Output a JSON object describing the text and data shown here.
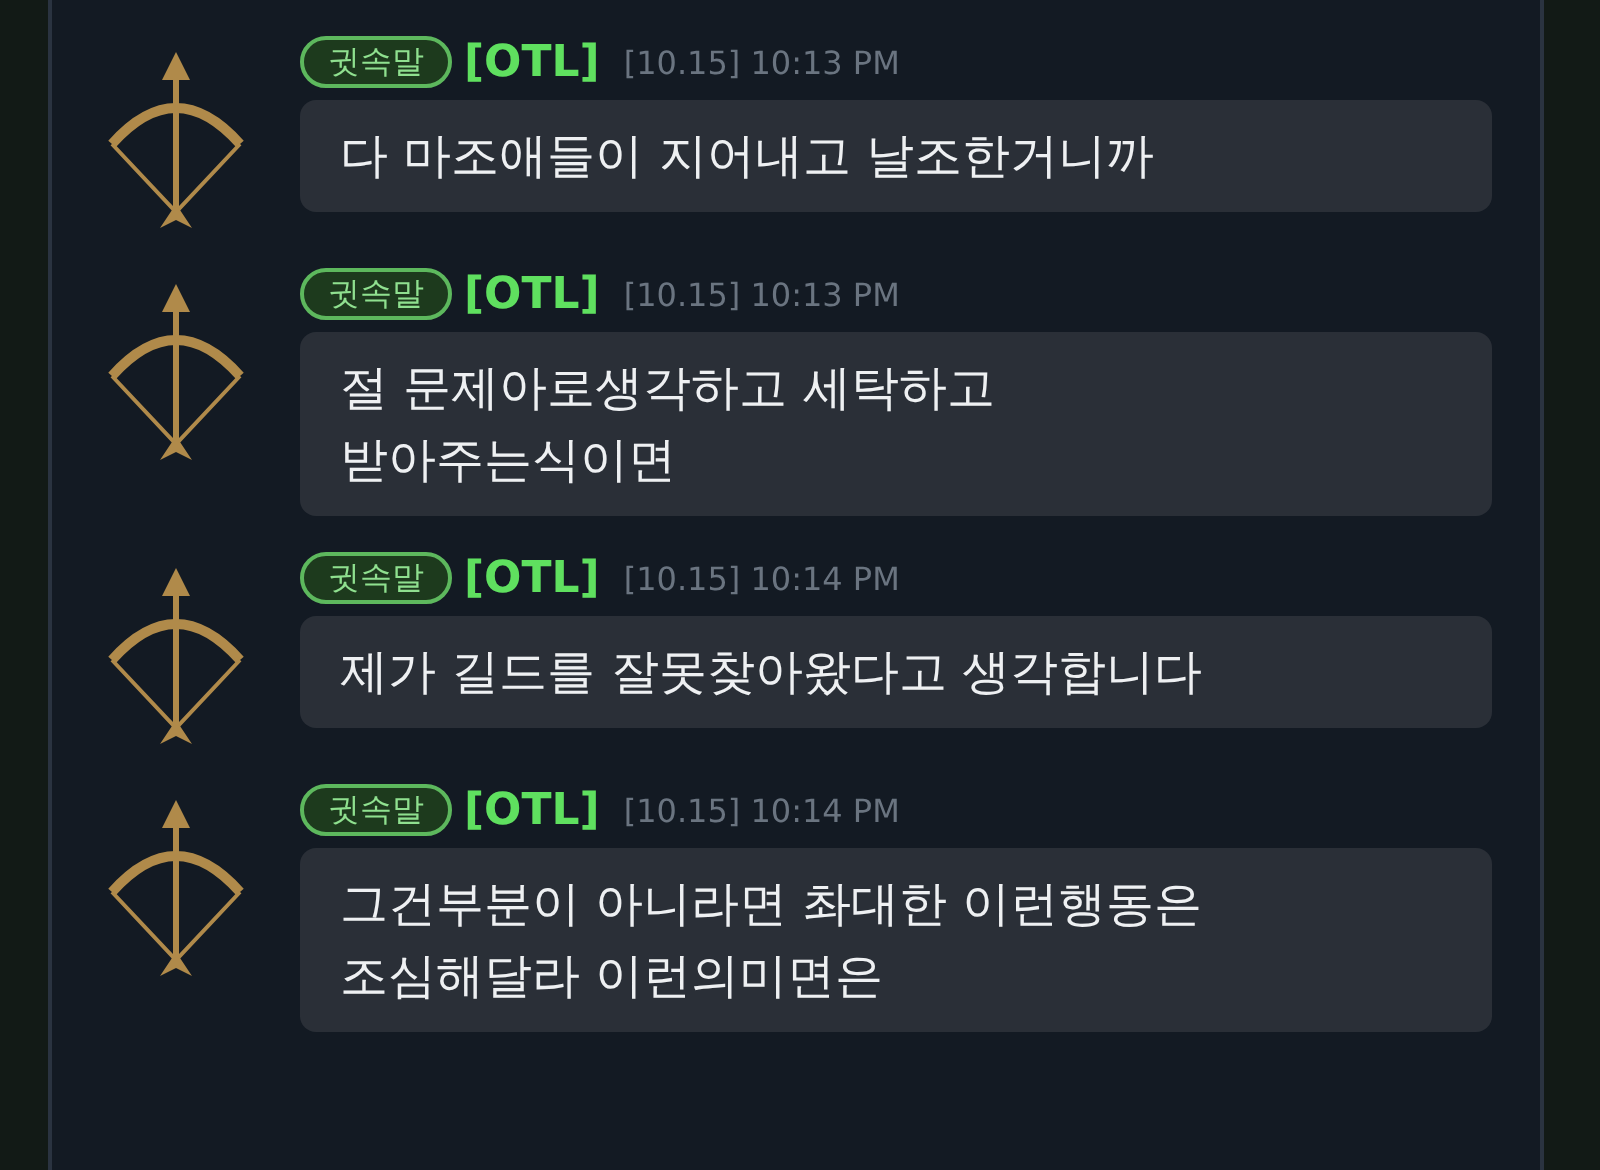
{
  "messages": [
    {
      "channel": "귓속말",
      "sender": "[OTL]",
      "time": "[10.15] 10:13 PM",
      "lines": [
        "다 마조애들이 지어내고 날조한거니까"
      ]
    },
    {
      "channel": "귓속말",
      "sender": "[OTL]",
      "time": "[10.15] 10:13 PM",
      "lines": [
        "절 문제아로생각하고 세탁하고",
        "받아주는식이면"
      ]
    },
    {
      "channel": "귓속말",
      "sender": "[OTL]",
      "time": "[10.15] 10:14 PM",
      "lines": [
        "제가 길드를 잘못찾아왔다고 생각합니다"
      ]
    },
    {
      "channel": "귓속말",
      "sender": "[OTL]",
      "time": "[10.15] 10:14 PM",
      "lines": [
        "그건부분이 아니라면 촤대한 이런행동은",
        "조심해달라 이런의미면은"
      ]
    }
  ]
}
